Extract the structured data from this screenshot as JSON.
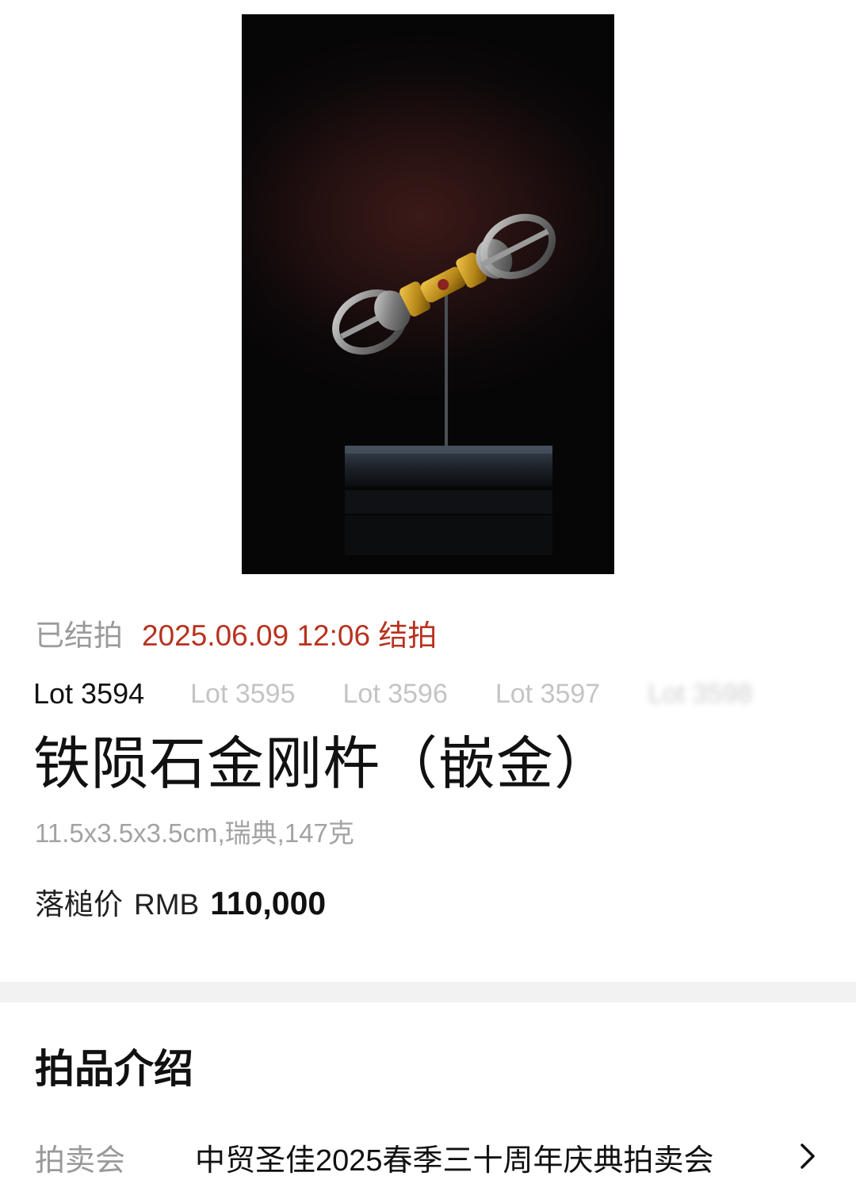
{
  "status": {
    "label": "已结拍",
    "time": "2025.06.09 12:06 结拍"
  },
  "lots": {
    "active": "Lot 3594",
    "others": [
      "Lot 3595",
      "Lot 3596",
      "Lot 3597",
      "Lot 3598"
    ]
  },
  "item": {
    "title": "铁陨石金刚杵（嵌金）",
    "spec": "11.5x3.5x3.5cm,瑞典,147克",
    "price_label": "落槌价",
    "currency": "RMB",
    "price": "110,000"
  },
  "intro": {
    "section_title": "拍品介绍",
    "auction_label": "拍卖会",
    "auction_value": "中贸圣佳2025春季三十周年庆典拍卖会"
  },
  "colors": {
    "status_time": "#b8321f",
    "muted": "#9a9a9a"
  },
  "icons": {
    "photo": "vajra-photo",
    "chevron": "chevron-right-icon"
  }
}
